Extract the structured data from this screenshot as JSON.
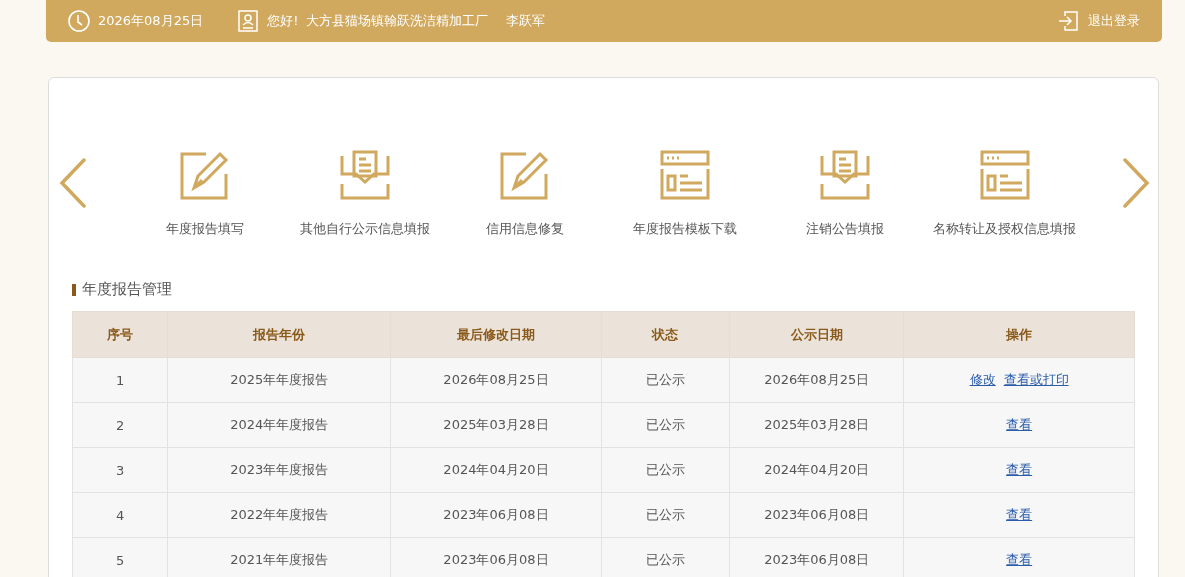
{
  "top_bar": {
    "date": "2026年08月25日",
    "greeting": "您好!",
    "company": "大方县猫场镇翰跃洗洁精加工厂",
    "user": "李跃军",
    "logout": "退出登录"
  },
  "shortcuts": [
    {
      "kind": "edit",
      "label": "年度报告填写"
    },
    {
      "kind": "inbox",
      "label": "其他自行公示信息填报"
    },
    {
      "kind": "edit",
      "label": "信用信息修复"
    },
    {
      "kind": "form",
      "label": "年度报告模板下载"
    },
    {
      "kind": "inbox",
      "label": "注销公告填报"
    },
    {
      "kind": "form",
      "label": "名称转让及授权信息填报"
    }
  ],
  "section_title": "年度报告管理",
  "table": {
    "columns": [
      "序号",
      "报告年份",
      "最后修改日期",
      "状态",
      "公示日期",
      "操作"
    ],
    "rows": [
      {
        "cells": [
          "1",
          "2025年年度报告",
          "2026年08月25日",
          "已公示",
          "2026年08月25日"
        ],
        "actions": [
          "修改",
          "查看或打印"
        ]
      },
      {
        "cells": [
          "2",
          "2024年年度报告",
          "2025年03月28日",
          "已公示",
          "2025年03月28日"
        ],
        "actions": [
          "查看"
        ]
      },
      {
        "cells": [
          "3",
          "2023年年度报告",
          "2024年04月20日",
          "已公示",
          "2024年04月20日"
        ],
        "actions": [
          "查看"
        ]
      },
      {
        "cells": [
          "4",
          "2022年年度报告",
          "2023年06月08日",
          "已公示",
          "2023年06月08日"
        ],
        "actions": [
          "查看"
        ]
      },
      {
        "cells": [
          "5",
          "2021年年度报告",
          "2023年06月08日",
          "已公示",
          "2023年06月08日"
        ],
        "actions": [
          "查看"
        ]
      }
    ]
  }
}
